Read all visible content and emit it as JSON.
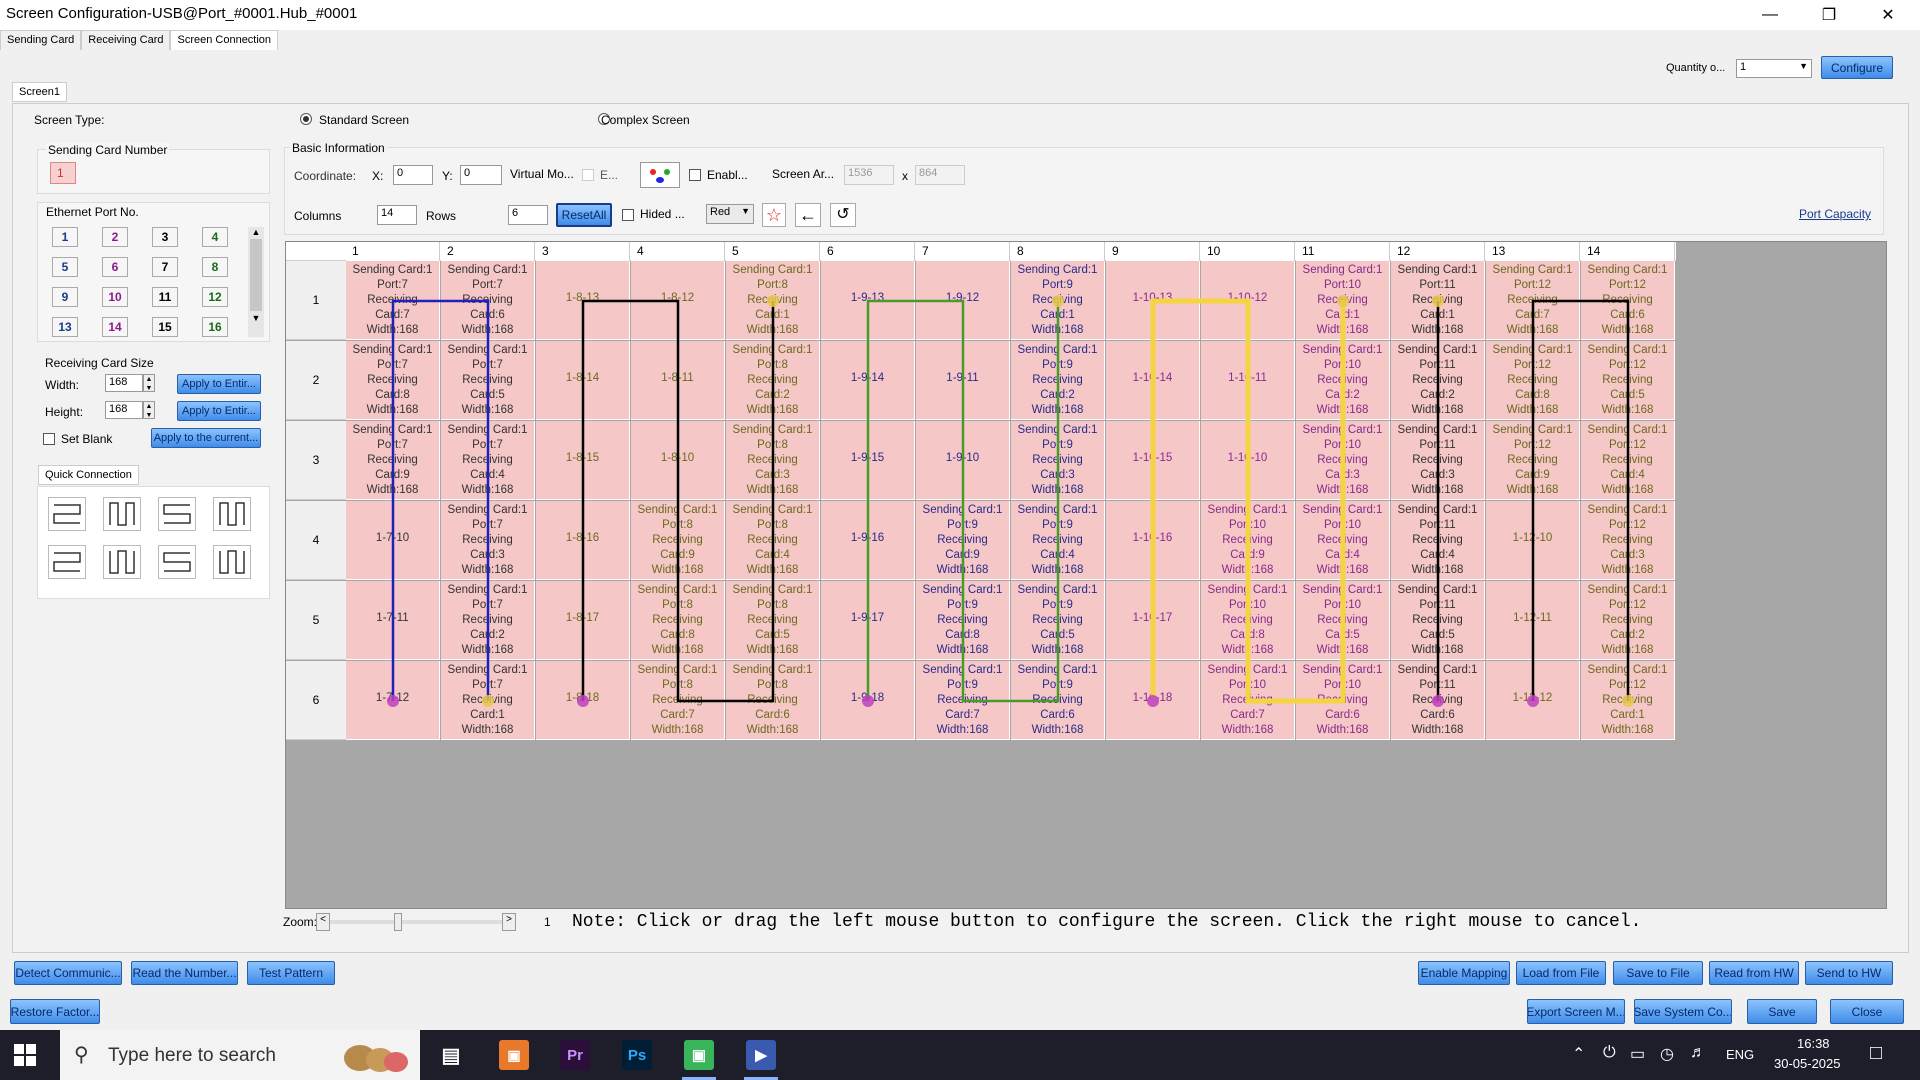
{
  "window": {
    "title": "Screen Configuration-USB@Port_#0001.Hub_#0001"
  },
  "tabs": [
    "Sending Card",
    "Receiving Card",
    "Screen Connection"
  ],
  "screen_tab": "Screen1",
  "top_right": {
    "quantity_label": "Quantity o...",
    "quantity_value": "1",
    "configure_label": "Configure"
  },
  "screen_type": {
    "label": "Screen Type:",
    "standard": "Standard Screen",
    "complex": "Complex Screen"
  },
  "sending_card_number": {
    "label": "Sending Card Number",
    "value": "1"
  },
  "ethernet": {
    "label": "Ethernet Port No.",
    "ports": [
      "1",
      "2",
      "3",
      "4",
      "5",
      "6",
      "7",
      "8",
      "9",
      "10",
      "11",
      "12",
      "13",
      "14",
      "15",
      "16"
    ],
    "colors": [
      "#1a3a8a",
      "#8a1a8a",
      "#000000",
      "#1a6a1a",
      "#1a3a8a",
      "#8a1a8a",
      "#000000",
      "#1a6a1a",
      "#1a3a8a",
      "#8a1a8a",
      "#000000",
      "#1a6a1a",
      "#1a3a8a",
      "#8a1a8a",
      "#000000",
      "#1a6a1a"
    ]
  },
  "receiving_card_size": {
    "label": "Receiving Card Size",
    "width_label": "Width:",
    "width_value": "168",
    "height_label": "Height:",
    "height_value": "168",
    "apply_entire_1": "Apply to Entir...",
    "apply_entire_2": "Apply to Entir...",
    "set_blank": "Set Blank",
    "apply_current": "Apply to the current..."
  },
  "quick_connection": {
    "label": "Quick Connection"
  },
  "basic_info": {
    "label": "Basic Information",
    "coordinate_label": "Coordinate:",
    "x_label": "X:",
    "x_value": "0",
    "y_label": "Y:",
    "y_value": "0",
    "virtual_mode": "Virtual Mo...",
    "e_label": "E...",
    "enable_label": "Enabl...",
    "screen_area_label": "Screen Ar...",
    "screen_w": "1536",
    "x_sep": "x",
    "screen_h": "864",
    "columns_label": "Columns",
    "columns_value": "14",
    "rows_label": "Rows",
    "rows_value": "6",
    "reset_all": "ResetAll",
    "hided_label": "Hided ...",
    "color_value": "Red",
    "port_capacity": "Port Capacity"
  },
  "grid": {
    "columns": [
      "1",
      "2",
      "3",
      "4",
      "5",
      "6",
      "7",
      "8",
      "9",
      "10",
      "11",
      "12",
      "13",
      "14"
    ],
    "rows": [
      "1",
      "2",
      "3",
      "4",
      "5",
      "6"
    ],
    "cells": [
      [
        "Sending Card:1|Port:7|Receiving|Card:7|Width:168",
        "Sending Card:1|Port:7|Receiving|Card:6|Width:168",
        "1-8-13",
        "1-8-12",
        "Sending Card:1|Port:8|Receiving|Card:1|Width:168",
        "1-9-13",
        "1-9-12",
        "Sending Card:1|Port:9|Receiving|Card:1|Width:168",
        "1-10-13",
        "1-10-12",
        "Sending Card:1|Port:10|Receiving|Card:1|Width:168",
        "Sending Card:1|Port:11|Receiving|Card:1|Width:168",
        "Sending Card:1|Port:12|Receiving|Card:7|Width:168",
        "Sending Card:1|Port:12|Receiving|Card:6|Width:168"
      ],
      [
        "Sending Card:1|Port:7|Receiving|Card:8|Width:168",
        "Sending Card:1|Port:7|Receiving|Card:5|Width:168",
        "1-8-14",
        "1-8-11",
        "Sending Card:1|Port:8|Receiving|Card:2|Width:168",
        "1-9-14",
        "1-9-11",
        "Sending Card:1|Port:9|Receiving|Card:2|Width:168",
        "1-10-14",
        "1-10-11",
        "Sending Card:1|Port:10|Receiving|Card:2|Width:168",
        "Sending Card:1|Port:11|Receiving|Card:2|Width:168",
        "Sending Card:1|Port:12|Receiving|Card:8|Width:168",
        "Sending Card:1|Port:12|Receiving|Card:5|Width:168"
      ],
      [
        "Sending Card:1|Port:7|Receiving|Card:9|Width:168",
        "Sending Card:1|Port:7|Receiving|Card:4|Width:168",
        "1-8-15",
        "1-8-10",
        "Sending Card:1|Port:8|Receiving|Card:3|Width:168",
        "1-9-15",
        "1-9-10",
        "Sending Card:1|Port:9|Receiving|Card:3|Width:168",
        "1-10-15",
        "1-10-10",
        "Sending Card:1|Port:10|Receiving|Card:3|Width:168",
        "Sending Card:1|Port:11|Receiving|Card:3|Width:168",
        "Sending Card:1|Port:12|Receiving|Card:9|Width:168",
        "Sending Card:1|Port:12|Receiving|Card:4|Width:168"
      ],
      [
        "1-7-10",
        "Sending Card:1|Port:7|Receiving|Card:3|Width:168",
        "1-8-16",
        "Sending Card:1|Port:8|Receiving|Card:9|Width:168",
        "Sending Card:1|Port:8|Receiving|Card:4|Width:168",
        "1-9-16",
        "Sending Card:1|Port:9|Receiving|Card:9|Width:168",
        "Sending Card:1|Port:9|Receiving|Card:4|Width:168",
        "1-10-16",
        "Sending Card:1|Port:10|Receiving|Card:9|Width:168",
        "Sending Card:1|Port:10|Receiving|Card:4|Width:168",
        "Sending Card:1|Port:11|Receiving|Card:4|Width:168",
        "1-12-10",
        "Sending Card:1|Port:12|Receiving|Card:3|Width:168"
      ],
      [
        "1-7-11",
        "Sending Card:1|Port:7|Receiving|Card:2|Width:168",
        "1-8-17",
        "Sending Card:1|Port:8|Receiving|Card:8|Width:168",
        "Sending Card:1|Port:8|Receiving|Card:5|Width:168",
        "1-9-17",
        "Sending Card:1|Port:9|Receiving|Card:8|Width:168",
        "Sending Card:1|Port:9|Receiving|Card:5|Width:168",
        "1-10-17",
        "Sending Card:1|Port:10|Receiving|Card:8|Width:168",
        "Sending Card:1|Port:10|Receiving|Card:5|Width:168",
        "Sending Card:1|Port:11|Receiving|Card:5|Width:168",
        "1-12-11",
        "Sending Card:1|Port:12|Receiving|Card:2|Width:168"
      ],
      [
        "1-7-12",
        "Sending Card:1|Port:7|Receiving|Card:1|Width:168",
        "1-8-18",
        "Sending Card:1|Port:8|Receiving|Card:7|Width:168",
        "Sending Card:1|Port:8|Receiving|Card:6|Width:168",
        "1-9-18",
        "Sending Card:1|Port:9|Receiving|Card:7|Width:168",
        "Sending Card:1|Port:9|Receiving|Card:6|Width:168",
        "1-10-18",
        "Sending Card:1|Port:10|Receiving|Card:7|Width:168",
        "Sending Card:1|Port:10|Receiving|Card:6|Width:168",
        "Sending Card:1|Port:11|Receiving|Card:6|Width:168",
        "1-12-12",
        "Sending Card:1|Port:12|Receiving|Card:1|Width:168"
      ]
    ],
    "port_colors": {
      "7": "#2020c0",
      "8": "#000000",
      "9": "#4a9a2a",
      "10": "#f5d442",
      "11": "#000000",
      "12": "#000000"
    },
    "cell_text_colors": {
      "8": "#6a6a20",
      "9": "#2a2a8a",
      "10": "#8a2a8a",
      "12": "#6a6a20"
    }
  },
  "zoom": {
    "label": "Zoom:",
    "value": "1",
    "note": "Note: Click or drag the left mouse button to configure the screen. Click the right mouse to cancel."
  },
  "bottom_buttons_1": [
    "Detect Communic...",
    "Read the Number...",
    "Test Pattern"
  ],
  "bottom_buttons_2": [
    "Enable Mapping",
    "Load from File",
    "Save to File",
    "Read from HW",
    "Send to HW"
  ],
  "bottom_buttons_3": [
    "Restore Factor..."
  ],
  "bottom_buttons_4": [
    "Export Screen M...",
    "Save System Co...",
    "Save",
    "Close"
  ],
  "taskbar": {
    "search_placeholder": "Type here to search",
    "lang": "ENG",
    "time": "16:38",
    "date": "30-05-2025"
  }
}
